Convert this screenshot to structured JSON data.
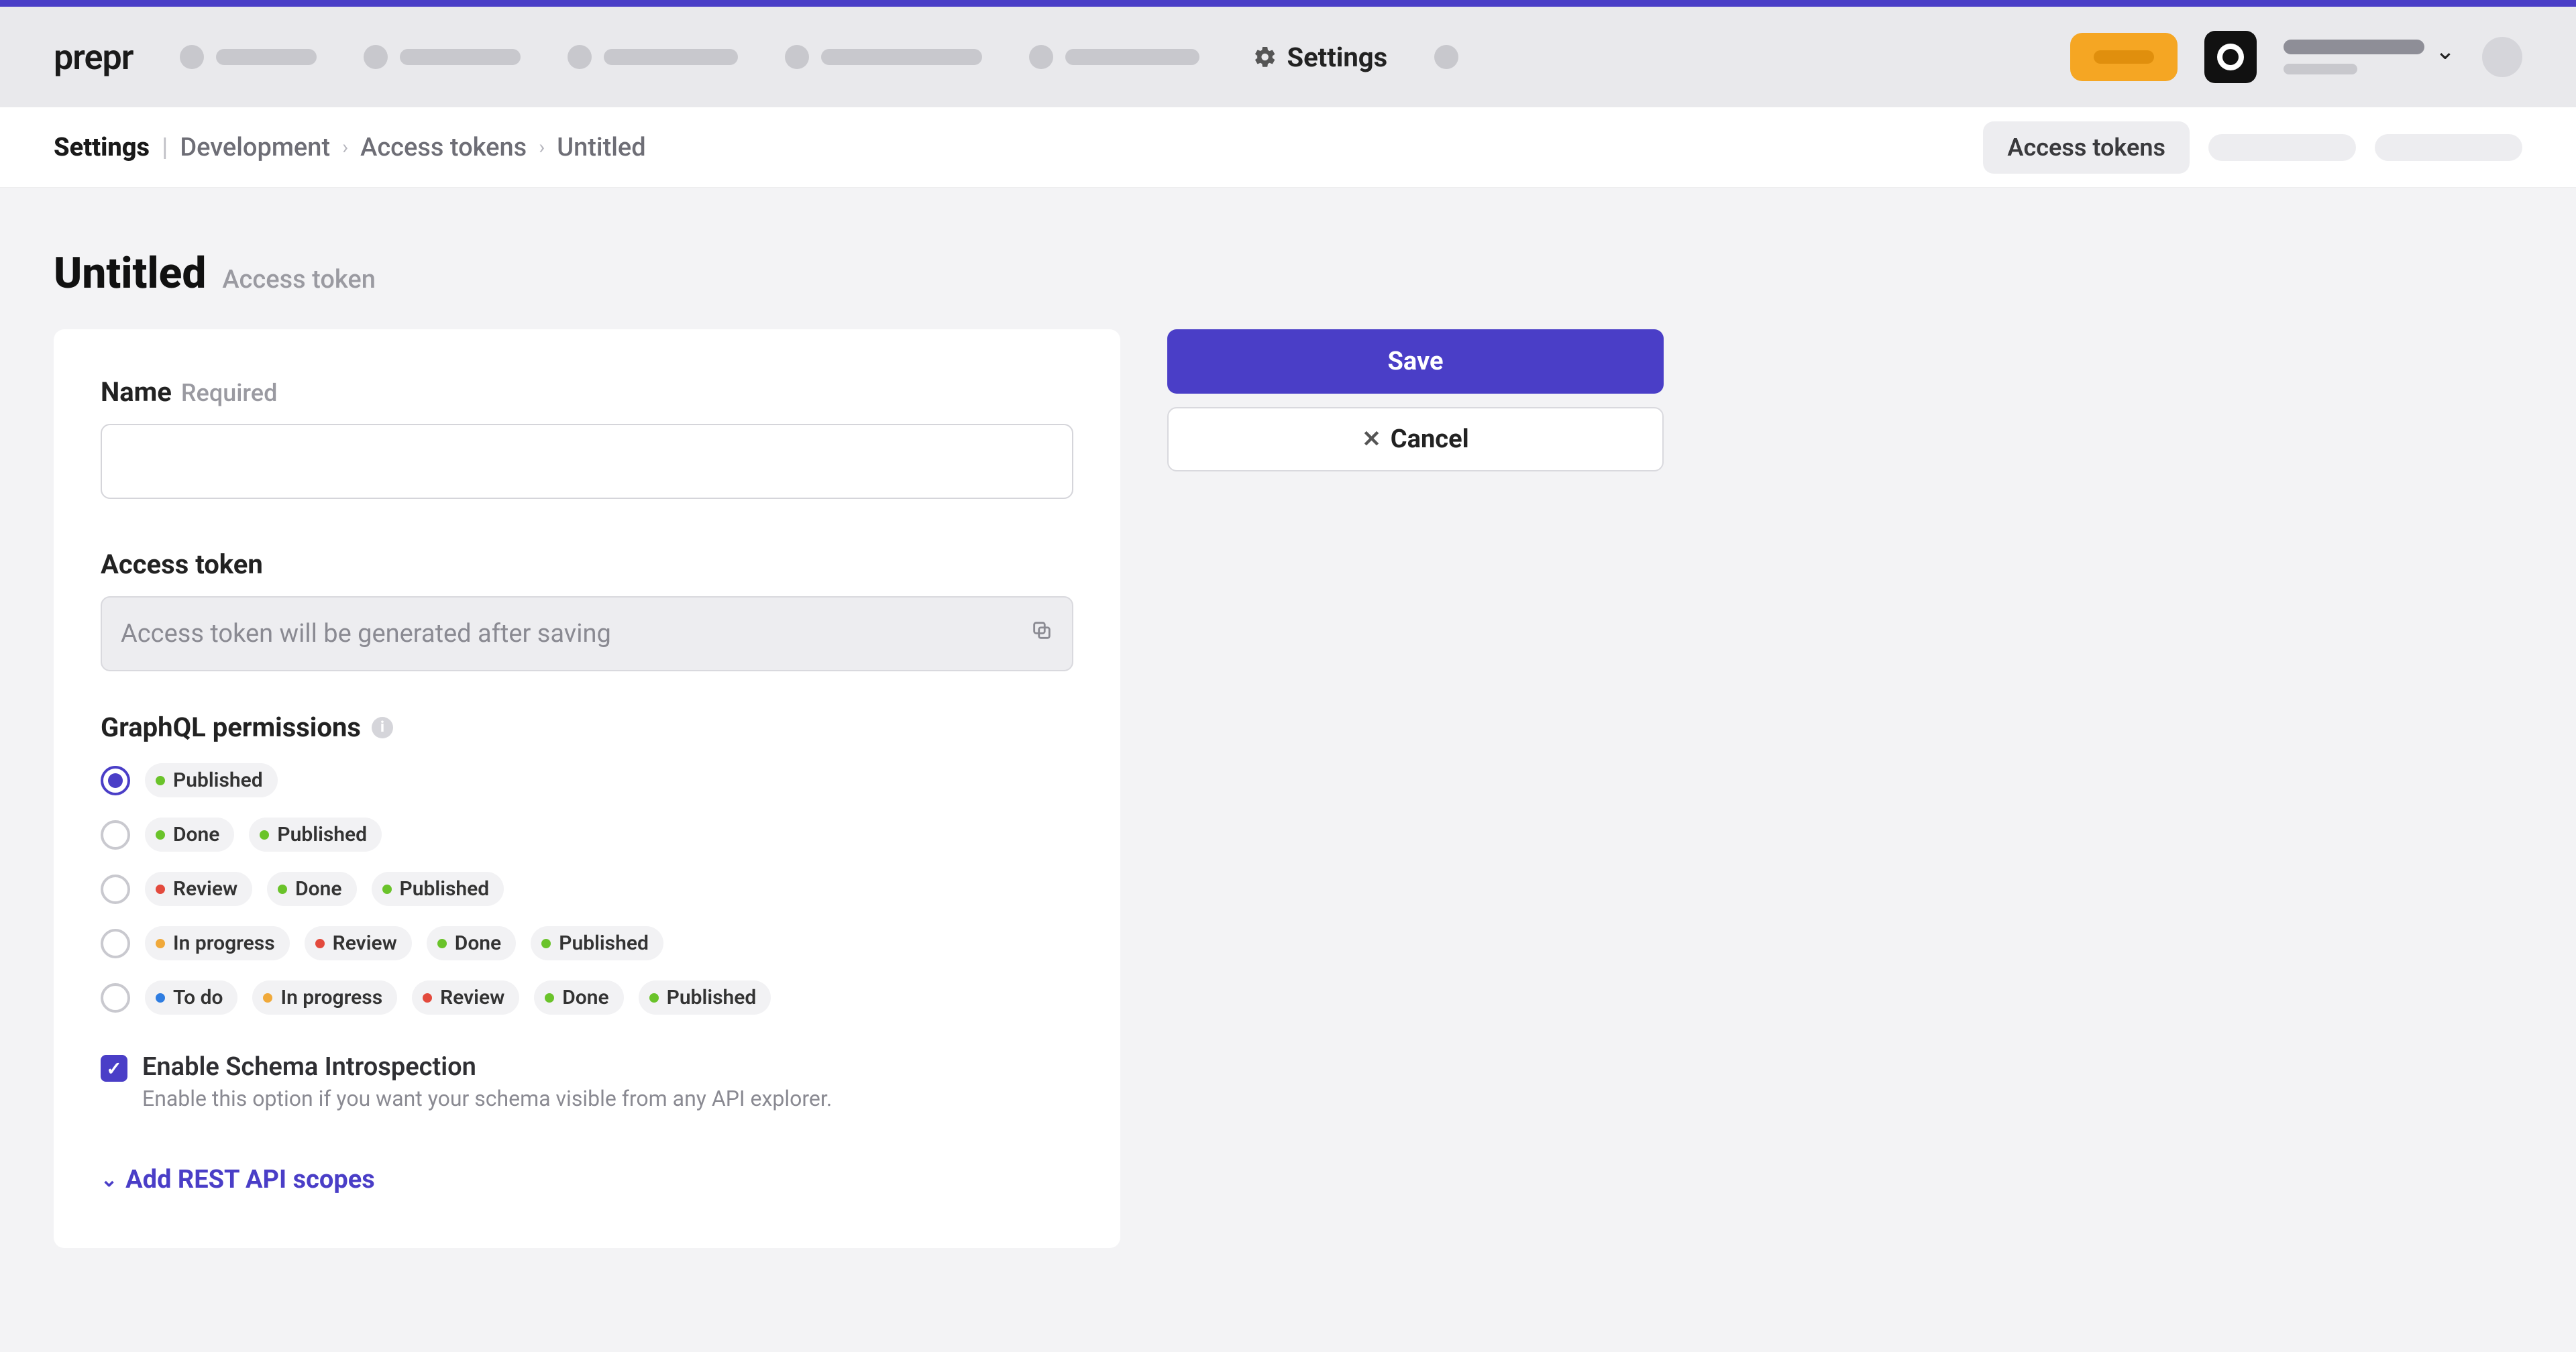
{
  "brand": {
    "name": "prepr"
  },
  "topnav": {
    "settings_label": "Settings"
  },
  "breadcrumb": {
    "root": "Settings",
    "items": [
      "Development",
      "Access tokens",
      "Untitled"
    ]
  },
  "tabs": {
    "active": "Access tokens"
  },
  "page": {
    "title": "Untitled",
    "subtitle": "Access token"
  },
  "form": {
    "name_label": "Name",
    "name_required": "Required",
    "name_value": "",
    "token_label": "Access token",
    "token_placeholder": "Access token will be generated after saving",
    "graphql_label": "GraphQL permissions",
    "permissions": [
      {
        "selected": true,
        "chips": [
          {
            "label": "Published",
            "color": "green"
          }
        ]
      },
      {
        "selected": false,
        "chips": [
          {
            "label": "Done",
            "color": "green"
          },
          {
            "label": "Published",
            "color": "green"
          }
        ]
      },
      {
        "selected": false,
        "chips": [
          {
            "label": "Review",
            "color": "red"
          },
          {
            "label": "Done",
            "color": "green"
          },
          {
            "label": "Published",
            "color": "green"
          }
        ]
      },
      {
        "selected": false,
        "chips": [
          {
            "label": "In progress",
            "color": "amber"
          },
          {
            "label": "Review",
            "color": "red"
          },
          {
            "label": "Done",
            "color": "green"
          },
          {
            "label": "Published",
            "color": "green"
          }
        ]
      },
      {
        "selected": false,
        "chips": [
          {
            "label": "To do",
            "color": "blue"
          },
          {
            "label": "In progress",
            "color": "amber"
          },
          {
            "label": "Review",
            "color": "red"
          },
          {
            "label": "Done",
            "color": "green"
          },
          {
            "label": "Published",
            "color": "green"
          }
        ]
      }
    ],
    "introspection": {
      "checked": true,
      "label": "Enable Schema Introspection",
      "help": "Enable this option if you want your schema visible from any API explorer."
    },
    "add_scopes": "Add REST API scopes"
  },
  "actions": {
    "save": "Save",
    "cancel": "Cancel"
  },
  "colors": {
    "accent": "#4a3ec7",
    "orange": "#f5a623"
  }
}
